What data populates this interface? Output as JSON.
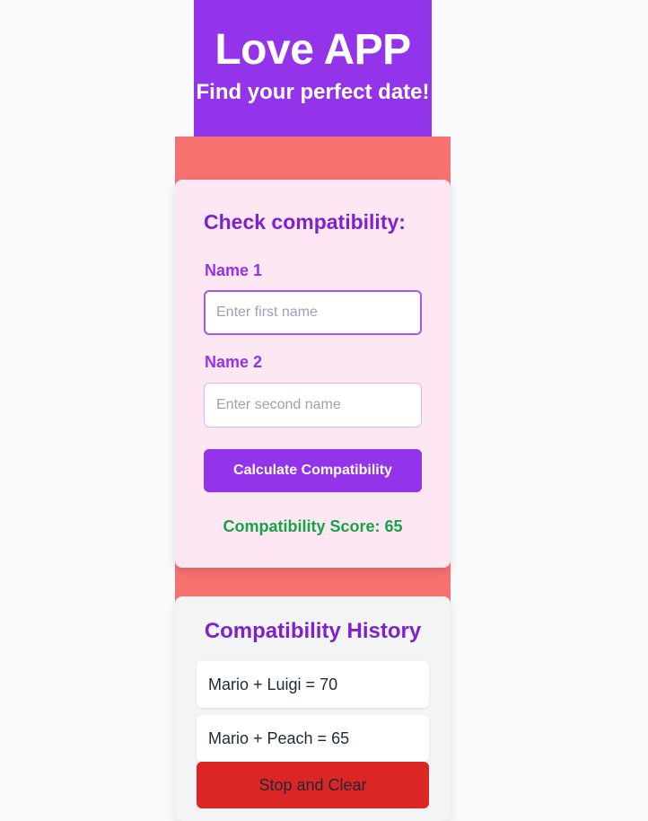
{
  "header": {
    "title": "Love APP",
    "subtitle": "Find your perfect date!"
  },
  "form": {
    "title": "Check compatibility:",
    "name1_label": "Name 1",
    "name1_placeholder": "Enter first name",
    "name1_value": "",
    "name2_label": "Name 2",
    "name2_placeholder": "Enter second name",
    "name2_value": "",
    "calculate_label": "Calculate Compatibility",
    "score_text": "Compatibility Score: 65"
  },
  "history": {
    "title": "Compatibility History",
    "items": [
      {
        "text": "Mario + Luigi = 70"
      },
      {
        "text": "Mario + Peach = 65"
      }
    ],
    "stop_label": "Stop and Clear"
  },
  "colors": {
    "header_bg": "#9333ea",
    "band_bg": "#f87171",
    "card_bg": "#fce7f3",
    "accent_purple": "#7e22ce",
    "score_green": "#16a34a",
    "stop_red": "#dc2626"
  }
}
